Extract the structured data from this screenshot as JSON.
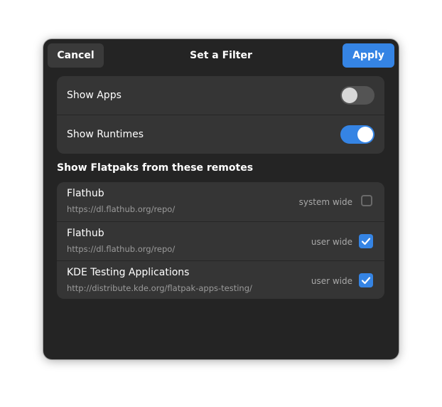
{
  "header": {
    "cancel_label": "Cancel",
    "title": "Set a Filter",
    "apply_label": "Apply"
  },
  "toggles": [
    {
      "label": "Show Apps",
      "on": false
    },
    {
      "label": "Show Runtimes",
      "on": true
    }
  ],
  "remotes_heading": "Show Flatpaks from these remotes",
  "remotes": [
    {
      "name": "Flathub",
      "url": "https://dl.flathub.org/repo/",
      "scope": "system wide",
      "checked": false
    },
    {
      "name": "Flathub",
      "url": "https://dl.flathub.org/repo/",
      "scope": "user wide",
      "checked": true
    },
    {
      "name": "KDE Testing Applications",
      "url": "http://distribute.kde.org/flatpak-apps-testing/",
      "scope": "user wide",
      "checked": true
    }
  ],
  "colors": {
    "accent": "#3584e4",
    "dialog_bg": "#242424",
    "card_bg": "#353535"
  },
  "icons": {
    "checkmark": "checkmark-icon"
  }
}
